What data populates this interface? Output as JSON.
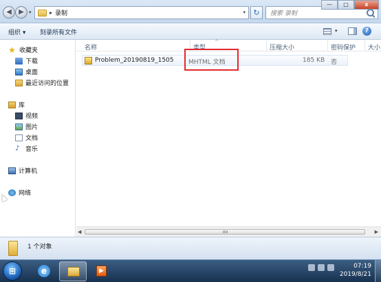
{
  "window": {
    "address": {
      "path": "录制"
    },
    "search": {
      "placeholder": "搜索 录制"
    },
    "controls": {
      "minimize": "—",
      "maximize": "□",
      "close": "x"
    }
  },
  "toolbar": {
    "organize": "组织 ▾",
    "burn": "刻录所有文件"
  },
  "navigation": {
    "favorites": {
      "label": "收藏夹",
      "items": [
        "下载",
        "桌面",
        "最近访问的位置"
      ]
    },
    "libraries": {
      "label": "库",
      "items": [
        "视频",
        "图片",
        "文档",
        "音乐"
      ]
    },
    "computer": "计算机",
    "network": "网络"
  },
  "columns": [
    "名称",
    "类型",
    "压缩大小",
    "密码保护",
    "大小"
  ],
  "files": [
    {
      "name": "Problem_20190819_1505",
      "type": "MHTML 文档",
      "compressed_size": "185 KB",
      "password": "否"
    }
  ],
  "details": {
    "summary": "1 个对象"
  },
  "taskbar": {
    "start": "⊞",
    "clock": {
      "time": "07:19",
      "date": "2019/8/21"
    }
  },
  "colors": {
    "highlight": "#e3262b",
    "taskbar": "#17314f",
    "title_bar": "#c5d8ee"
  }
}
